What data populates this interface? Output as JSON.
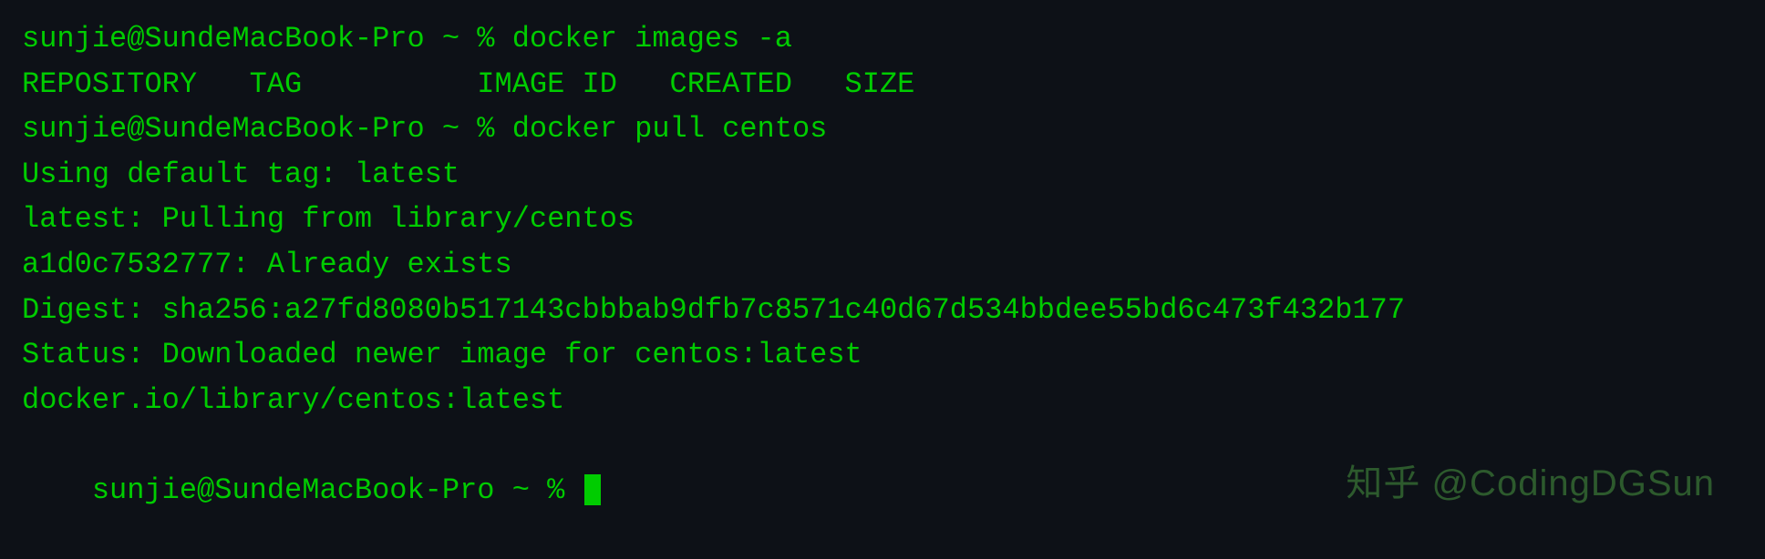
{
  "terminal": {
    "background": "#0d1117",
    "text_color": "#00cc00"
  },
  "lines": [
    {
      "id": "line1",
      "text": "sunjie@SundeMacBook-Pro ~ % docker images -a"
    },
    {
      "id": "line2",
      "text": "REPOSITORY   TAG          IMAGE ID   CREATED   SIZE"
    },
    {
      "id": "line3",
      "text": "sunjie@SundeMacBook-Pro ~ % docker pull centos"
    },
    {
      "id": "line4",
      "text": "Using default tag: latest"
    },
    {
      "id": "line5",
      "text": "latest: Pulling from library/centos"
    },
    {
      "id": "line6",
      "text": "a1d0c7532777: Already exists"
    },
    {
      "id": "line7",
      "text": "Digest: sha256:a27fd8080b517143cbbbab9dfb7c8571c40d67d534bbdee55bd6c473f432b177"
    },
    {
      "id": "line8",
      "text": "Status: Downloaded newer image for centos:latest"
    },
    {
      "id": "line9",
      "text": "docker.io/library/centos:latest"
    },
    {
      "id": "line10",
      "text": "sunjie@SundeMacBook-Pro ~ % "
    }
  ],
  "watermark": {
    "text": "知乎 @CodingDGSun"
  }
}
